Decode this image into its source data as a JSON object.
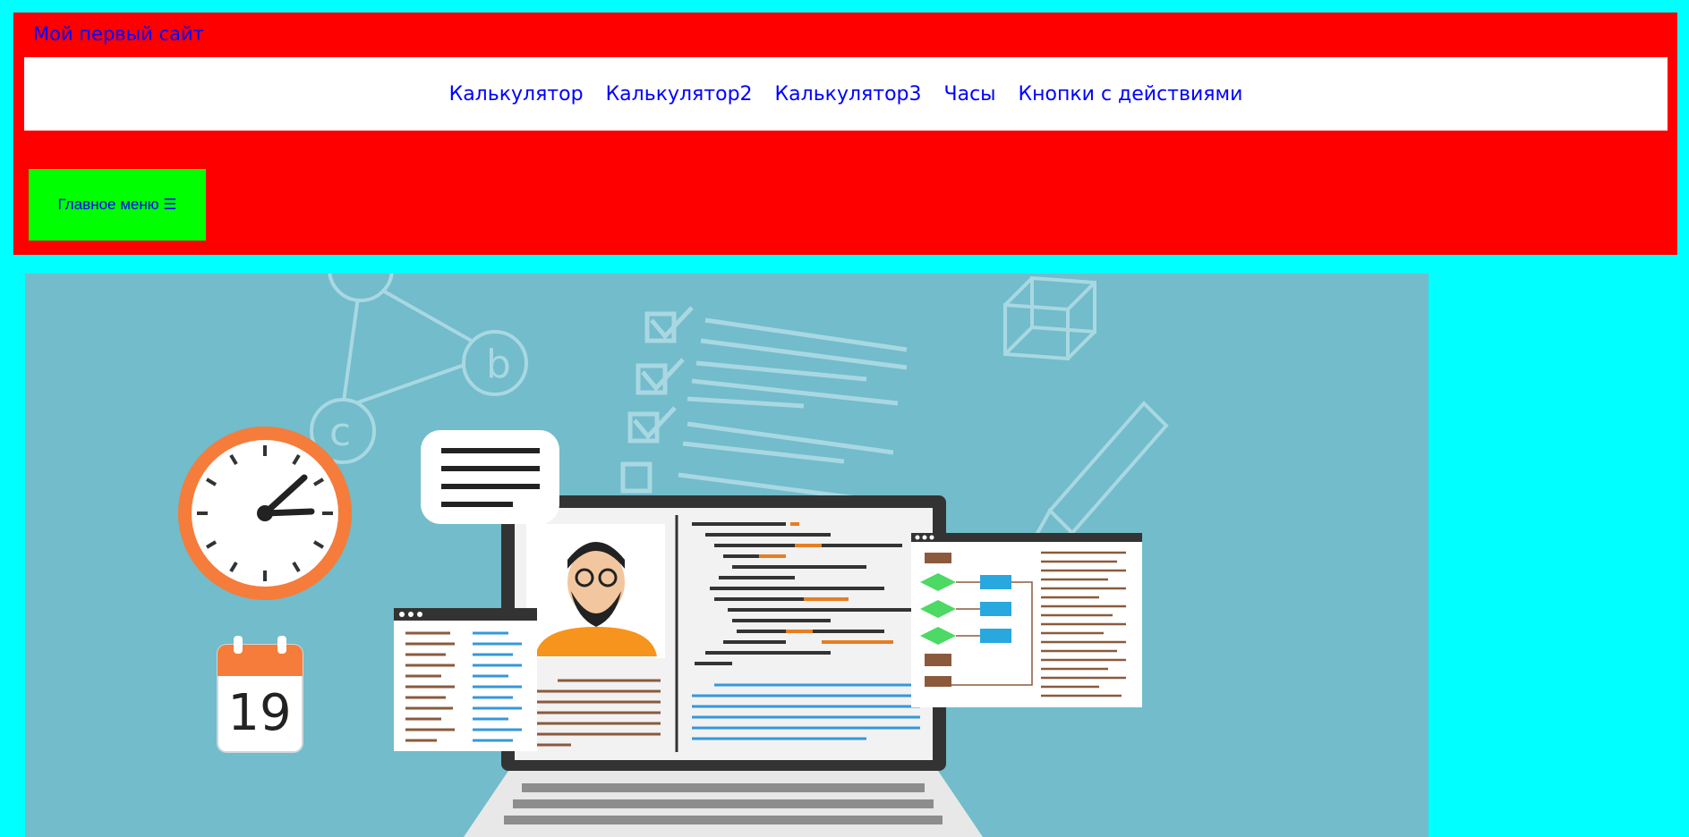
{
  "header": {
    "site_title": "Мой первый сайт",
    "nav": [
      {
        "label": "Калькулятор"
      },
      {
        "label": "Калькулятор2"
      },
      {
        "label": "Калькулятор3"
      },
      {
        "label": "Часы"
      },
      {
        "label": "Кнопки с действиями"
      }
    ],
    "menu_button_label": "Главное меню ☰"
  },
  "hero": {
    "calendar_day": "19",
    "bubble_letters": [
      "b",
      "c"
    ]
  },
  "colors": {
    "page_bg": "#00ffff",
    "header_bg": "#ff0000",
    "nav_bg": "#ffffff",
    "link": "#0000ff",
    "menu_button_bg": "#00ff00",
    "illustration_bg": "#72bccb"
  }
}
